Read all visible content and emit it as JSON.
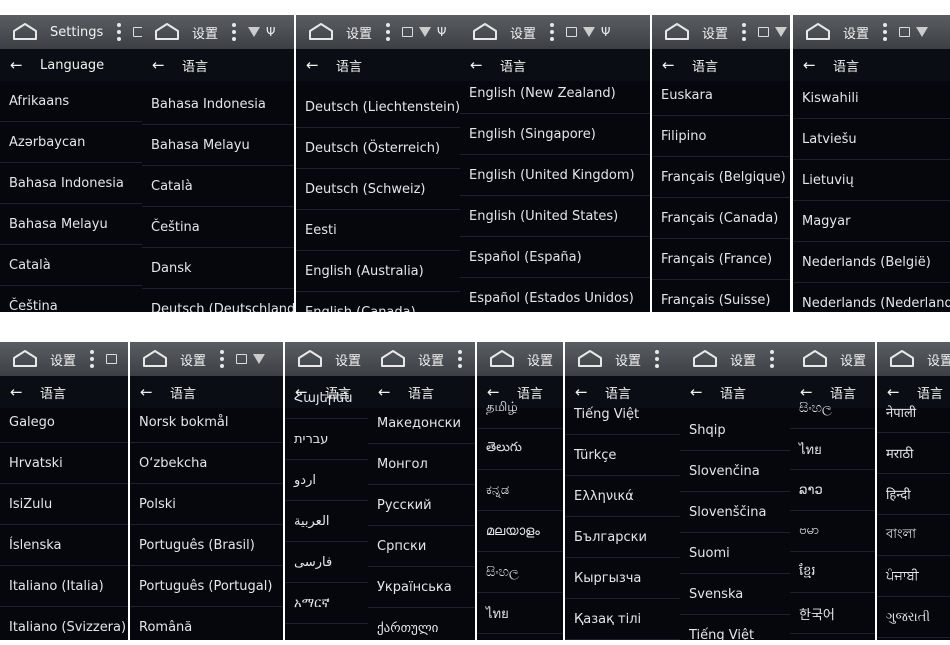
{
  "screens": [
    {
      "title": "Settings",
      "header": "Language",
      "icons": [
        "more-icon",
        "image-icon"
      ],
      "items": [
        "Afrikaans",
        "Azərbaycan",
        "Bahasa Indonesia",
        "Bahasa Melayu",
        "Català",
        "Čeština"
      ]
    },
    {
      "title": "设置",
      "header": "语言",
      "icons": [
        "more-icon",
        "wifi-icon",
        "usb-icon"
      ],
      "items": [
        "Bahasa Indonesia",
        "Bahasa Melayu",
        "Català",
        "Čeština",
        "Dansk",
        "Deutsch (Deutschland)"
      ]
    },
    {
      "title": "设置",
      "header": "语言",
      "icons": [
        "more-icon",
        "image-icon",
        "wifi-icon",
        "usb-icon"
      ],
      "items": [
        "Deutsch (Liechtenstein)",
        "Deutsch (Österreich)",
        "Deutsch (Schweiz)",
        "Eesti",
        "English (Australia)",
        "English (Canada)"
      ]
    },
    {
      "title": "设置",
      "header": "语言",
      "icons": [
        "more-icon",
        "image-icon",
        "wifi-icon",
        "usb-icon"
      ],
      "items": [
        "English (New Zealand)",
        "English (Singapore)",
        "English (United Kingdom)",
        "English (United States)",
        "Español (España)",
        "Español (Estados Unidos)"
      ]
    },
    {
      "title": "设置",
      "header": "语言",
      "icons": [
        "more-icon",
        "image-icon",
        "wifi-icon"
      ],
      "items": [
        "Euskara",
        "Filipino",
        "Français (Belgique)",
        "Français (Canada)",
        "Français (France)",
        "Français (Suisse)"
      ]
    },
    {
      "title": "设置",
      "header": "语言",
      "icons": [
        "more-icon",
        "image-icon",
        "wifi-icon"
      ],
      "items": [
        "Kiswahili",
        "Latviešu",
        "Lietuvių",
        "Magyar",
        "Nederlands (België)",
        "Nederlands (Nederland)"
      ]
    },
    {
      "title": "设置",
      "header": "语言",
      "icons": [
        "more-icon",
        "image-icon"
      ],
      "items": [
        "Galego",
        "Hrvatski",
        "IsiZulu",
        "Íslenska",
        "Italiano (Italia)",
        "Italiano (Svizzera)"
      ]
    },
    {
      "title": "设置",
      "header": "语言",
      "icons": [
        "more-icon",
        "image-icon",
        "wifi-icon"
      ],
      "items": [
        "Norsk bokmål",
        "O‘zbekcha",
        "Polski",
        "Português (Brasil)",
        "Português (Portugal)",
        "Română"
      ]
    },
    {
      "title": "设置",
      "header": "语言",
      "icons": [
        "more-icon"
      ],
      "items": [
        "Հայերեն",
        "עברית",
        "اردو",
        "العربية",
        "فارسی",
        "አማርኛ"
      ]
    },
    {
      "title": "设置",
      "header": "语言",
      "icons": [
        "more-icon"
      ],
      "items": [
        "Македонски",
        "Монгол",
        "Русский",
        "Српски",
        "Українська",
        "ქართული"
      ]
    },
    {
      "title": "设置",
      "header": "语言",
      "icons": [
        "more-icon"
      ],
      "items": [
        "தமிழ்",
        "తెలుగు",
        "ಕನ್ನಡ",
        "മലയാളം",
        "සිංහල",
        "ไทย"
      ]
    },
    {
      "title": "设置",
      "header": "语言",
      "icons": [
        "more-icon"
      ],
      "items": [
        "Tiếng Việt",
        "Türkçe",
        "Ελληνικά",
        "Български",
        "Кыргызча",
        "Қазақ тілі"
      ]
    },
    {
      "title": "设置",
      "header": "语言",
      "icons": [
        "more-icon"
      ],
      "items": [
        "Shqip",
        "Slovenčina",
        "Slovenščina",
        "Suomi",
        "Svenska",
        "Tiếng Việt"
      ]
    },
    {
      "title": "设置",
      "header": "语言",
      "icons": [],
      "items": [
        "සිංහල",
        "ไทย",
        "ລາວ",
        "ဗမာ",
        "ខ្មែរ",
        "한국어"
      ]
    },
    {
      "title": "设置",
      "header": "语言",
      "icons": [],
      "items": [
        "नेपाली",
        "मराठी",
        "हिन्दी",
        "বাংলা",
        "ਪੰਜਾਬੀ",
        "ગુજરાતી"
      ]
    }
  ]
}
